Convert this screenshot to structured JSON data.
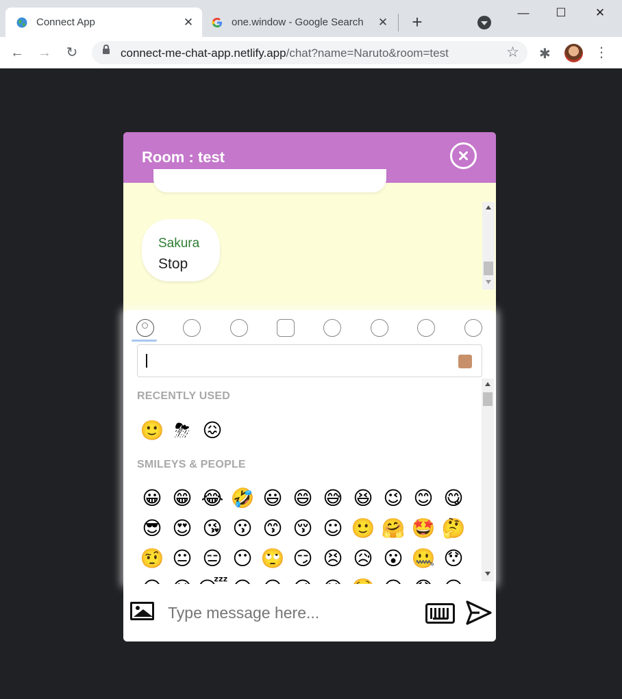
{
  "browser": {
    "tabs": [
      {
        "title": "Connect App",
        "active": true,
        "favicon": "globe-icon"
      },
      {
        "title": "one.window - Google Search",
        "active": false,
        "favicon": "google-g-icon"
      }
    ],
    "close_glyph": "✕",
    "new_tab_glyph": "+",
    "address": {
      "domain": "connect-me-chat-app.netlify.app",
      "path": "/chat?name=Naruto&room=test"
    },
    "window_controls": {
      "minimize": "—",
      "maximize": "☐",
      "close": "✕"
    },
    "nav": {
      "back": "←",
      "forward": "→",
      "reload": "↻"
    },
    "star_glyph": "☆",
    "extensions_glyph": "✱",
    "menu_glyph": "⋮"
  },
  "chat": {
    "header_title": "Room : test",
    "header_color": "#c477cb",
    "background_color": "#fdfdd8",
    "messages": [
      {
        "sender": "Sakura",
        "text": "Stop"
      }
    ]
  },
  "emoji_picker": {
    "categories": [
      "people-icon",
      "nature-icon",
      "food-icon",
      "places-icon",
      "activity-icon",
      "objects-icon",
      "symbols-icon",
      "flags-icon"
    ],
    "active_category": "people-icon",
    "skin_tone_color": "#c8906a",
    "recently_used_title": "RECENTLY USED",
    "recently_used": [
      "🙂",
      "⛈",
      "😖"
    ],
    "smileys_title": "SMILEYS & PEOPLE",
    "smileys_rows": [
      [
        "😀",
        "😁",
        "😂",
        "🤣",
        "😃",
        "😄",
        "😅",
        "😆",
        "😉",
        "😊",
        "😋"
      ],
      [
        "😎",
        "😍",
        "😘",
        "😗",
        "😙",
        "😚",
        "☺",
        "🙂",
        "🤗",
        "🤩",
        "🤔"
      ],
      [
        "🤨",
        "😐",
        "😑",
        "😶",
        "🙄",
        "😏",
        "😣",
        "😥",
        "😮",
        "🤐",
        "😯"
      ],
      [
        "😪",
        "😫",
        "😴",
        "😌",
        "😛",
        "😜",
        "😝",
        "🤤",
        "😒",
        "😓",
        "😔"
      ]
    ]
  },
  "input_bar": {
    "placeholder": "Type message here..."
  }
}
